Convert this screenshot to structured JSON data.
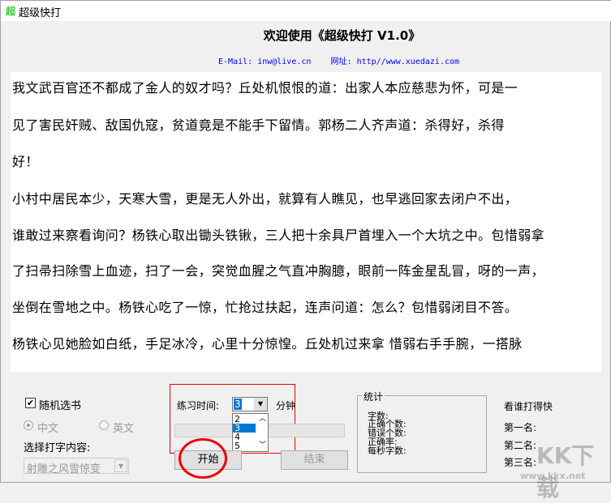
{
  "window": {
    "title": "超级快打",
    "icon": "app-logo-icon"
  },
  "header": {
    "welcome": "欢迎使用《超级快打 V1.0》",
    "email_label": "E-Mail:",
    "email": "inw@live.cn",
    "site_label": "网址:",
    "site": "http//www.xuedazi.com"
  },
  "text_lines": [
    "我文武百官还不都成了金人的奴才吗？丘处机恨恨的道：出家人本应慈悲为怀，可是一",
    "见了害民奸贼、敌国仇寇，贫道竟是不能手下留情。郭杨二人齐声道：杀得好，杀得",
    "好！",
    "小村中居民本少，天寒大雪，更是无人外出，就算有人瞧见，也早逃回家去闭户不出，",
    "谁敢过来察看询问？杨铁心取出锄头铁锹，三人把十余具尸首埋入一个大坑之中。包惜弱拿",
    "了扫帚扫除雪上血迹，扫了一会，突觉血腥之气直冲胸臆，眼前一阵金星乱冒，呀的一声，",
    "坐倒在雪地之中。杨铁心吃了一惊，忙抢过扶起，连声问道：怎么？包惜弱闭目不答。",
    "杨铁心见她脸如白纸，手足冰冷，心里十分惊惶。丘处机过来拿   惜弱右手手腕，一搭脉"
  ],
  "controls": {
    "random_book": "随机选书",
    "random_checked": true,
    "chinese": "中文",
    "english": "英文",
    "content_label": "选择打字内容:",
    "content_value": "射雕之风雪惊变",
    "time_label": "练习时间:",
    "time_value": "3",
    "time_unit": "分钟",
    "time_options": [
      "2",
      "3",
      "4",
      "5"
    ],
    "time_selected": "3",
    "start": "开始",
    "end": "结束"
  },
  "stats": {
    "legend": "统计",
    "chars": "字数:",
    "correct": "正确个数:",
    "wrong": "错误个数:",
    "accuracy": "正确率:",
    "speed": "每秒字数:"
  },
  "ranking": {
    "title": "看谁打得快",
    "first": "第一名:",
    "second": "第二名:",
    "third": "第三名:"
  },
  "watermark": {
    "logo": "KK下载",
    "url": "www.kkx.net"
  }
}
